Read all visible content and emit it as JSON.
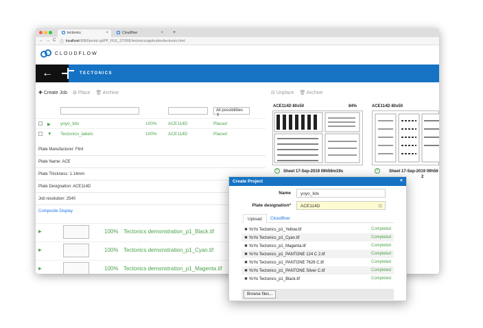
{
  "browser": {
    "tabs": [
      {
        "title": "tectonics",
        "close": "×"
      },
      {
        "title": "Cloudflow",
        "close": "×"
      }
    ],
    "new_tab": "+",
    "nav": {
      "back": "←",
      "forward": "→",
      "reload": "C",
      "info": "ⓘ"
    },
    "url_host": "localhost",
    "url_path": ":9090/portal.cgi/PP_FILE_STORE/tectonics/application/tectonics.html",
    "dots": [
      "#ff5f56",
      "#ffbd2e",
      "#27c93f"
    ]
  },
  "brand": {
    "name": "CLOUDFLOW"
  },
  "header": {
    "back": "←",
    "app_name": "TECTONICS",
    "accent": "#1673c4"
  },
  "toolbar": {
    "create": "Create Job",
    "place": "Place",
    "archive": "Archive"
  },
  "filters": {
    "status_select": "All possibilities ⇕"
  },
  "jobs": [
    {
      "name": "yoyo_lids",
      "progress": "100%",
      "plate": "ACE114D",
      "status": "Placed"
    },
    {
      "name": "Tectonics_labels",
      "progress": "100%",
      "plate": "ACE114D",
      "status": "Placed"
    }
  ],
  "details": [
    "Plate Manufacturer: Flint",
    "Plate Name: ACE",
    "Plate Thickness: 1.14mm",
    "Plate Designation: ACE114D",
    "Job resolution: 2540"
  ],
  "composite": "Composite Display",
  "separations": [
    {
      "progress": "100%",
      "name": "Tectonics demonstration_p1_Black.tif"
    },
    {
      "progress": "100%",
      "name": "Tectonics demonstration_p1_Cyan.tif"
    },
    {
      "progress": "100%",
      "name": "Tectonics demonstration_p1_Magenta.tif"
    }
  ],
  "right_toolbar": {
    "unplace": "Unplace",
    "archive": "Archive"
  },
  "plates": [
    {
      "title": "ACE114D 80x50",
      "usage": "84%",
      "sheet": "Sheet 17-Sep-2019 09h56m19s"
    },
    {
      "title": "ACE114D 80x50",
      "sheet": "Sheet 17-Sep-2019 09h56",
      "sheet_line2": "2"
    }
  ],
  "modal": {
    "title": "Create Project",
    "close": "×",
    "name_label": "Name",
    "name_value": "yoyo_lids",
    "designation_label": "Plate designation*",
    "designation_value": "ACE114D",
    "tabs": [
      "Upload",
      "Cloudflow"
    ],
    "files": [
      {
        "name": "✖ YoYo Tectonics_p1_Yellow.tif",
        "status": "Completed"
      },
      {
        "name": "✖ YoYo Tectonics_p1_Cyan.tif",
        "status": "Completed"
      },
      {
        "name": "✖ YoYo Tectonics_p1_Magenta.tif",
        "status": "Completed"
      },
      {
        "name": "✖ YoYo Tectonics_p1_PANTONE 124 C 2.tif",
        "status": "Completed"
      },
      {
        "name": "✖ YoYo Tectonics_p1_PANTONE 7626 C.tif",
        "status": "Completed"
      },
      {
        "name": "✖ YoYo Tectonics_p1_PANTONE Silver C.tif",
        "status": "Completed"
      },
      {
        "name": "✖ YoYo Tectonics_p1_Black.tif",
        "status": "Completed"
      }
    ],
    "browse": "Browse files..."
  }
}
